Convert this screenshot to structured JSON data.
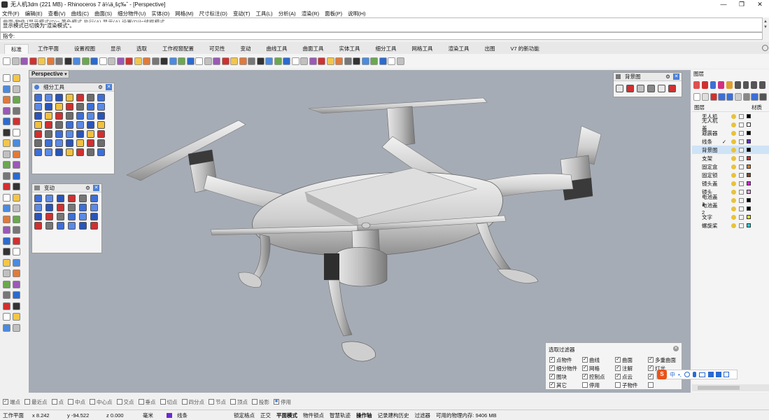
{
  "window": {
    "title": "无人机3dm (221 MB) - Rhinoceros 7 ä¼ä¸šç‰ˆ - [Perspective]",
    "minimize": "—",
    "maximize": "❐",
    "close": "✕"
  },
  "menubar": [
    "文件(F)",
    "编辑(E)",
    "查看(V)",
    "曲线(C)",
    "曲面(S)",
    "细分物件(U)",
    "实体(O)",
    "网格(M)",
    "尺寸标注(D)",
    "变动(T)",
    "工具(L)",
    "分析(A)",
    "渲染(R)",
    "面板(P)",
    "说明(H)"
  ],
  "command": {
    "history_cut": "曲面-物件 [显示模式(D)= 著色模式  执行(A)  显示(A)  设置(D)]=线框模式",
    "history": "显示模式已切换为\"渲染模式\"。",
    "prompt": "指令:"
  },
  "tabs": [
    "标准",
    "工作平面",
    "设置视图",
    "显示",
    "选取",
    "工作视窗配置",
    "可见性",
    "变动",
    "曲线工具",
    "曲面工具",
    "实体工具",
    "细分工具",
    "网格工具",
    "渲染工具",
    "出图",
    "V7 的新功能"
  ],
  "active_tab": "标准",
  "viewport": {
    "label": "Perspective",
    "dropdown": "▾"
  },
  "panels": {
    "subd": {
      "title": "细分工具"
    },
    "transform": {
      "title": "变动"
    },
    "background": {
      "title": "背景图"
    }
  },
  "layers_panel": {
    "title": "图层",
    "col_layer": "图层",
    "col_material": "材质",
    "rows": [
      {
        "name": "无人机",
        "color": "#000000",
        "check": ""
      },
      {
        "name": "无人机盖",
        "color": "#ffffff",
        "check": ""
      },
      {
        "name": "避震器",
        "color": "#000000",
        "check": ""
      },
      {
        "name": "线条",
        "color": "#6a2bd0",
        "check": "✓"
      },
      {
        "name": "背景图",
        "color": "#000000",
        "check": ""
      },
      {
        "name": "支架",
        "color": "#d03030",
        "check": ""
      },
      {
        "name": "固定盒",
        "color": "#e87a1a",
        "check": ""
      },
      {
        "name": "固定锁",
        "color": "#7a4a22",
        "check": ""
      },
      {
        "name": "镜头盖",
        "color": "#e020e0",
        "check": ""
      },
      {
        "name": "镜头",
        "color": "#e0a0e0",
        "check": ""
      },
      {
        "name": "电池盖1",
        "color": "#000000",
        "check": ""
      },
      {
        "name": "电池盖2",
        "color": "#000000",
        "check": ""
      },
      {
        "name": "文字",
        "color": "#f0e020",
        "check": ""
      },
      {
        "name": "螺旋桨",
        "color": "#20d0d8",
        "check": ""
      }
    ]
  },
  "selection_filter": {
    "title": "选取过滤器",
    "items": [
      {
        "label": "点物件",
        "checked": "✓"
      },
      {
        "label": "曲线",
        "checked": "✓"
      },
      {
        "label": "曲面",
        "checked": "✓"
      },
      {
        "label": "多重曲面",
        "checked": "✓"
      },
      {
        "label": "细分物件",
        "checked": "✓"
      },
      {
        "label": "网格",
        "checked": "✓"
      },
      {
        "label": "注解",
        "checked": "✓"
      },
      {
        "label": "灯光",
        "checked": "✓"
      },
      {
        "label": "图块",
        "checked": "✓"
      },
      {
        "label": "控制点",
        "checked": "✓"
      },
      {
        "label": "点云",
        "checked": "✓"
      },
      {
        "label": "",
        "checked": "✓"
      },
      {
        "label": "其它",
        "checked": "✓"
      },
      {
        "label": "停用",
        "checked": ""
      },
      {
        "label": "子物件",
        "checked": ""
      },
      {
        "label": "",
        "checked": ""
      }
    ]
  },
  "ime_bar": {
    "logo": "S",
    "lang": "中",
    "punct": "•,"
  },
  "osnap": [
    {
      "label": "端点",
      "checked": "✓"
    },
    {
      "label": "最近点",
      "checked": ""
    },
    {
      "label": "点",
      "checked": ""
    },
    {
      "label": "中点",
      "checked": ""
    },
    {
      "label": "中心点",
      "checked": ""
    },
    {
      "label": "交点",
      "checked": ""
    },
    {
      "label": "垂点",
      "checked": ""
    },
    {
      "label": "切点",
      "checked": ""
    },
    {
      "label": "四分点",
      "checked": ""
    },
    {
      "label": "节点",
      "checked": ""
    },
    {
      "label": "顶点",
      "checked": ""
    },
    {
      "label": "投影",
      "checked": ""
    },
    {
      "label": "停用",
      "checked": "■"
    }
  ],
  "status_bar": {
    "cplane": "工作平面",
    "x": "x 8.242",
    "y": "y -94.522",
    "z": "z 0.000",
    "unit": "毫米",
    "layer": "线条",
    "layer_color": "#6a2bd0",
    "items": [
      "锁定格点",
      "正交",
      "平面模式",
      "物件锁点",
      "智慧轨迹",
      "操作轴",
      "记录建构历史",
      "过滤器",
      "可用的物理内存: 9406 MB"
    ]
  },
  "colors": {
    "viewport_bg": "#a6acb5",
    "highlight_row": "#cfe3f7",
    "accent": "#4a7fd4"
  }
}
